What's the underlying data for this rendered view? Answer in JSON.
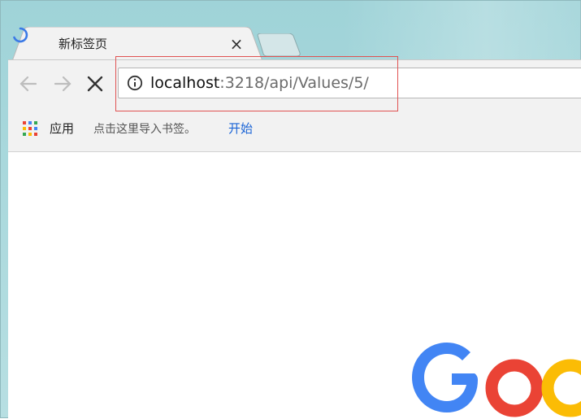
{
  "tab": {
    "title": "新标签页",
    "close_label": "×",
    "spinner_icon": "loading-spinner-icon"
  },
  "toolbar": {
    "back_icon": "arrow-left-icon",
    "forward_icon": "arrow-right-icon",
    "stop_icon": "close-icon"
  },
  "omnibox": {
    "info_icon": "info-circle-icon",
    "url_host": "localhost",
    "url_rest": ":3218/api/Values/5/"
  },
  "bookmarks": {
    "apps_label": "应用",
    "hint": "点击这里导入书签。",
    "start_link": "开始"
  },
  "colors": {
    "accent_blue": "#1a64d6",
    "highlight_red": "#e05252",
    "google_blue": "#4285f4",
    "google_red": "#ea4335",
    "google_yellow": "#fbbc05"
  }
}
